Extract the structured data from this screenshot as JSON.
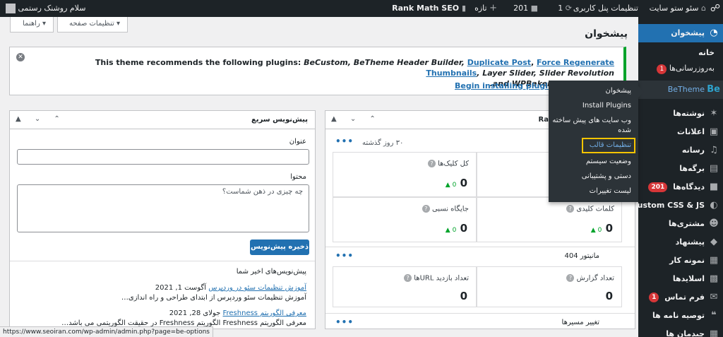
{
  "adminbar": {
    "wp_logo": "wordpress-icon",
    "site_name": "سئو ستو سایت",
    "user_settings": "تنظیمات پنل کاربری",
    "updates": "1",
    "comments": "201",
    "new": "تازه",
    "rank_math": "Rank Math SEO",
    "greeting": "سلام روشنک رستمی"
  },
  "screen_options": {
    "page_settings": "تنظیمات صفحه",
    "help": "راهنما"
  },
  "page_title": "پیشخوان",
  "notice": {
    "prefix": "This theme recommends the following plugins: ",
    "p1": "BeCustom, BeTheme Header Builder, ",
    "link1": "Duplicate Post",
    "sep1": ", ",
    "link2": "Force Regenerate Thumbnails",
    "p2": ", Layer Slider, Slider Revolution",
    "line2": ".and  WPBakery Page Builder",
    "action_install": "Begin installing plugins",
    "action_sep": "|"
  },
  "sidebar": {
    "dashboard": "پیشخوان",
    "home": "خانه",
    "updates": "بەروزرسانی‌ها",
    "updates_count": "1",
    "betheme": "BeTheme",
    "posts": "نوشته‌ها",
    "notifications": "اعلانات",
    "media": "رسانه",
    "pages": "برگه‌ها",
    "comments": "دیدگاه‌ها",
    "comments_count": "201",
    "custom_css": "Custom CSS & JS",
    "customers": "مشتری‌ها",
    "offers": "پیشنهاد",
    "portfolio": "نمونه کار",
    "slides": "اسلایدها",
    "contact": "فرم تماس",
    "contact_count": "1",
    "testimonials": "توصیه نامه ها",
    "layouts": "چیدمان ها"
  },
  "flyout": {
    "items": [
      "پیشخوان",
      "Install Plugins",
      "وب سایت های پیش ساخته شده",
      "تنظیمات قالب",
      "وضعیت سیستم",
      "دستی و پشتیبانی",
      "لیست تغییرات"
    ]
  },
  "quick_draft": {
    "title": "پیش‌نویس سریع",
    "title_label": "عنوان",
    "content_label": "محتوا",
    "placeholder": "چه چیزی در ذهن شماست؟",
    "save": "ذخیره پیش‌نویس",
    "recent_title": "پیش‌نویس‌های اخیر شما",
    "drafts": [
      {
        "title": "آموزش تنظیمات سئو در وردپرس",
        "date": "آگوست 1, 2021",
        "excerpt": "آموزش تنظیمات سئو وردپرس از ابتدای طراحی و راه اندازی…"
      },
      {
        "title": "معرفی الگوریتم Freshness",
        "date": "جولای 28, 2021",
        "excerpt": "معرفی الگوریتم Freshness الگوریتم Freshness در حقیقت الگوریتمی می باشد…"
      }
    ]
  },
  "rankmath": {
    "title": "Ra",
    "period": "۳۰ روز گذشته",
    "total_clicks": "کل کلیک‌ها",
    "avg_position": "جایگاه نسبی",
    "keywords": "کلمات کلیدی",
    "zero": "0",
    "delta": "0",
    "monitor_404": "مانیتور 404",
    "report_count": "تعداد گزارش",
    "url_visits": "تعداد بازدید URLها",
    "redirects": "تغییر مسیرها"
  },
  "statusbar": "https://www.seoiran.com/wp-admin/admin.php?page=be-options",
  "colors": {
    "adminbar": "#1d2327",
    "accent": "#2271b1",
    "highlight": "#f5c400",
    "notice_border": "#00a32a",
    "badge": "#d63638"
  }
}
